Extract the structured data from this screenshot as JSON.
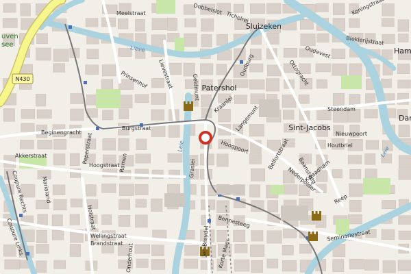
{
  "map": {
    "colors": {
      "background": "#f2efe9",
      "block": "#d9d0c9",
      "water": "#aad3df",
      "motorway": "#f7f68c",
      "road_yellow": "#fbfac8",
      "park": "#c8e6a8",
      "rail": "#888888",
      "marker": "#cc3322"
    },
    "places": [
      {
        "name": "Sluizeken"
      },
      {
        "name": "Patershol"
      },
      {
        "name": "Sint-Jacobs"
      },
      {
        "name": "Ham"
      },
      {
        "name": "Dam"
      }
    ],
    "streets": [
      {
        "name": "Meelstraat"
      },
      {
        "name": "Tichelrei"
      },
      {
        "name": "Dobbelslot"
      },
      {
        "name": "Koningstraat"
      },
      {
        "name": "Bieklerijstraat"
      },
      {
        "name": "Oudevest"
      },
      {
        "name": "Lievestraat"
      },
      {
        "name": "Prinsenhof"
      },
      {
        "name": "Geldmunt"
      },
      {
        "name": "Oudburg"
      },
      {
        "name": "Kraanlei"
      },
      {
        "name": "Steendam"
      },
      {
        "name": "Burgstraat"
      },
      {
        "name": "Beginengracht"
      },
      {
        "name": "Peperstraat"
      },
      {
        "name": "Langemunt"
      },
      {
        "name": "Hoogpoort"
      },
      {
        "name": "Belfortstraat"
      },
      {
        "name": "Nieuwpoort"
      },
      {
        "name": "Houtbriel"
      },
      {
        "name": "Hoogstraat"
      },
      {
        "name": "Akkerstraat"
      },
      {
        "name": "Ramen"
      },
      {
        "name": "Graslei"
      },
      {
        "name": "Baansteeg"
      },
      {
        "name": "Kwaadham"
      },
      {
        "name": "Nederpolder"
      },
      {
        "name": "Reep"
      },
      {
        "name": "Seminariestraat"
      },
      {
        "name": "Wellingstraat"
      },
      {
        "name": "Brandstraat"
      },
      {
        "name": "Onderhout"
      },
      {
        "name": "Bennesteeg"
      },
      {
        "name": "Jan Breydel"
      },
      {
        "name": "Korte Meer"
      },
      {
        "name": "Coupure Links"
      },
      {
        "name": "Coupure Rechts"
      },
      {
        "name": "Marialand"
      },
      {
        "name": "Holstraat"
      },
      {
        "name": "Ottogracht"
      },
      {
        "name": "Sint-Jacobsnieuwstraat"
      }
    ],
    "water_labels": [
      {
        "name": "Lieve"
      },
      {
        "name": "Leie"
      },
      {
        "name": "Lieve"
      },
      {
        "name": "Leie"
      }
    ],
    "partial_labels": [
      {
        "name": "uven"
      },
      {
        "name": "see"
      }
    ],
    "road_shield": "N430",
    "marker_icon": "location-pin-icon",
    "landmark_icon": "castle-icon"
  }
}
